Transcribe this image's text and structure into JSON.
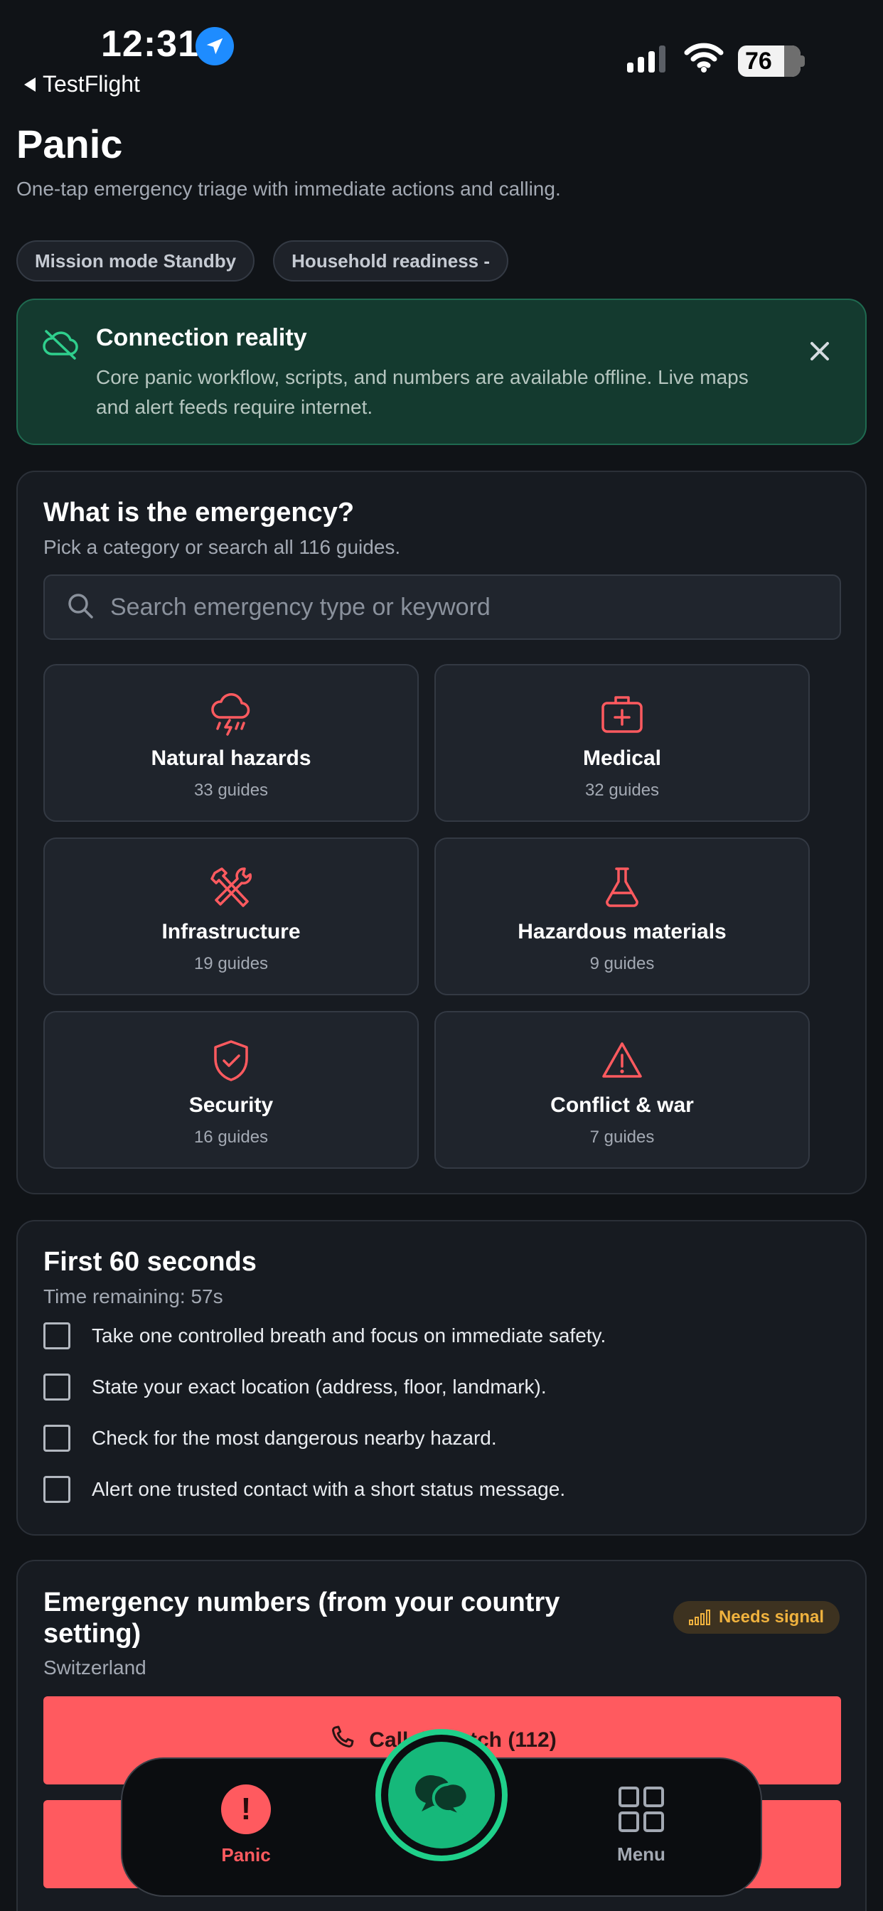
{
  "status_bar": {
    "time": "12:31",
    "back_label": "TestFlight",
    "battery": "76"
  },
  "header": {
    "title": "Panic",
    "subtitle": "One-tap emergency triage with immediate actions and calling.",
    "chips": [
      "Mission mode Standby",
      "Household readiness -"
    ]
  },
  "banner": {
    "title": "Connection reality",
    "text": "Core panic workflow, scripts, and numbers are available offline. Live maps and alert feeds require internet."
  },
  "emergency": {
    "title": "What is the emergency?",
    "subtitle": "Pick a category or search all 116 guides.",
    "search_placeholder": "Search emergency type or keyword",
    "categories": [
      {
        "icon": "storm-cloud-icon",
        "name": "Natural hazards",
        "count": "33 guides"
      },
      {
        "icon": "medical-kit-icon",
        "name": "Medical",
        "count": "32 guides"
      },
      {
        "icon": "tools-icon",
        "name": "Infrastructure",
        "count": "19 guides"
      },
      {
        "icon": "flask-icon",
        "name": "Hazardous materials",
        "count": "9 guides"
      },
      {
        "icon": "shield-check-icon",
        "name": "Security",
        "count": "16 guides"
      },
      {
        "icon": "warning-triangle-icon",
        "name": "Conflict & war",
        "count": "7 guides"
      }
    ]
  },
  "first60": {
    "title": "First 60 seconds",
    "timer": "Time remaining: 57s",
    "items": [
      "Take one controlled breath and focus on immediate safety.",
      "State your exact location (address, floor, landmark).",
      "Check for the most dangerous nearby hazard.",
      "Alert one trusted contact with a short status message."
    ]
  },
  "numbers": {
    "title": "Emergency numbers (from your country setting)",
    "country": "Switzerland",
    "badge": "Needs signal",
    "call_label": "Call dispatch (112)"
  },
  "tabbar": {
    "panic": "Panic",
    "menu": "Menu"
  },
  "colors": {
    "accent_red": "#ff5a5f",
    "accent_green": "#1fd08a",
    "banner_bg": "#143a2f",
    "warning": "#f0b23e"
  }
}
